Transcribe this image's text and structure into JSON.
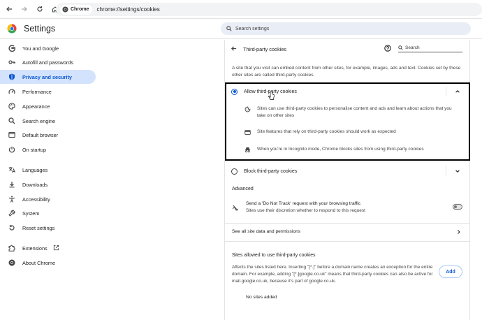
{
  "browser": {
    "chip_label": "Chrome",
    "url": "chrome://settings/cookies"
  },
  "header": {
    "title": "Settings",
    "search_placeholder": "Search settings"
  },
  "sidebar": {
    "items": [
      {
        "label": "You and Google",
        "icon": "google-icon"
      },
      {
        "label": "Autofill and passwords",
        "icon": "key-icon"
      },
      {
        "label": "Privacy and security",
        "icon": "shield-icon",
        "active": true
      },
      {
        "label": "Performance",
        "icon": "speedometer-icon"
      },
      {
        "label": "Appearance",
        "icon": "palette-icon"
      },
      {
        "label": "Search engine",
        "icon": "search-icon"
      },
      {
        "label": "Default browser",
        "icon": "browser-icon"
      },
      {
        "label": "On startup",
        "icon": "power-icon"
      },
      {
        "label": "Languages",
        "icon": "translate-icon"
      },
      {
        "label": "Downloads",
        "icon": "download-icon"
      },
      {
        "label": "Accessibility",
        "icon": "accessibility-icon"
      },
      {
        "label": "System",
        "icon": "wrench-icon"
      },
      {
        "label": "Reset settings",
        "icon": "reset-icon"
      },
      {
        "label": "Extensions",
        "icon": "puzzle-icon"
      },
      {
        "label": "About Chrome",
        "icon": "chrome-icon"
      }
    ]
  },
  "main": {
    "title": "Third-party cookies",
    "search_placeholder": "Search",
    "description": "A site that you visit can embed content from other sites, for example, images, ads and text. Cookies set by these other sites are called third-party cookies.",
    "allow_option": {
      "label": "Allow third-party cookies",
      "checked": true,
      "details": [
        {
          "icon": "cookie-icon",
          "text": "Sites can use third-party cookies to personalise content and ads and learn about actions that you take on other sites"
        },
        {
          "icon": "web-page-icon",
          "text": "Site features that rely on third-party cookies should work as expected"
        },
        {
          "icon": "incognito-icon",
          "text": "When you're in Incognito mode, Chrome blocks sites from using third-party cookies"
        }
      ]
    },
    "block_option": {
      "label": "Block third-party cookies",
      "checked": false
    },
    "advanced": {
      "heading": "Advanced",
      "dnt_title": "Send a 'Do Not Track' request with your browsing traffic",
      "dnt_sub": "Sites use their discretion whether to respond to this request",
      "dnt_enabled": false
    },
    "see_all_label": "See all site data and permissions",
    "allowed_sites": {
      "heading": "Sites allowed to use third-party cookies",
      "description": "Affects the sites listed here. Inserting \"[*.]\" before a domain name creates an exception for the entire domain. For example, adding \"[*.]google.co.uk\" means that third-party cookies can also be active for mail.google.co.uk, because it's part of google.co.uk.",
      "add_label": "Add",
      "empty_label": "No sites added"
    }
  },
  "colors": {
    "accent": "#0b57d0",
    "active_bg": "#d3e3fd",
    "search_bg": "#e9eef6"
  }
}
